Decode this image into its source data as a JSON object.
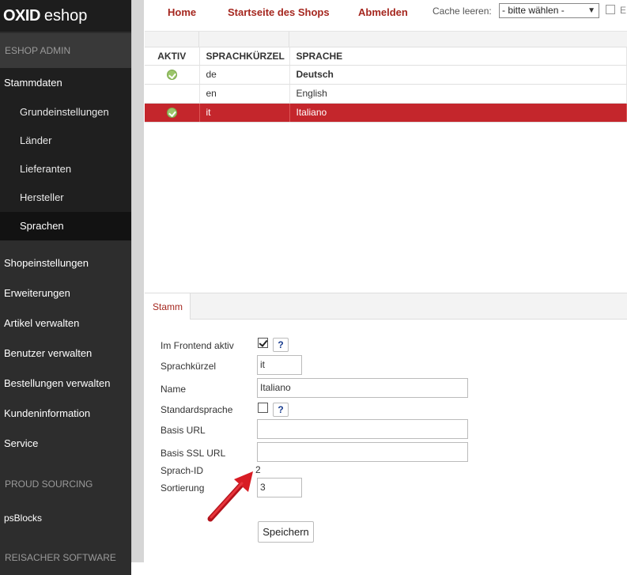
{
  "logo": {
    "brand": "OXID",
    "product": "eshop"
  },
  "sidebar": {
    "section_admin": "ESHOP ADMIN",
    "stammdaten": "Stammdaten",
    "sub_items": [
      "Grundeinstellungen",
      "Länder",
      "Lieferanten",
      "Hersteller",
      "Sprachen"
    ],
    "active_sub": "Sprachen",
    "menu_items": [
      "Shopeinstellungen",
      "Erweiterungen",
      "Artikel verwalten",
      "Benutzer verwalten",
      "Bestellungen verwalten",
      "Kundeninformation",
      "Service"
    ],
    "section_proud": "PROUD SOURCING",
    "psblocks": "psBlocks",
    "section_reisacher": "REISACHER SOFTWARE"
  },
  "topnav": {
    "home": "Home",
    "startseite": "Startseite des Shops",
    "abmelden": "Abmelden",
    "cache_label": "Cache leeren:",
    "cache_select": "- bitte wählen -",
    "extra_label": "E"
  },
  "list": {
    "headers": {
      "aktiv": "AKTIV",
      "kuerzel": "SPRACHKÜRZEL",
      "sprache": "SPRACHE"
    },
    "rows": [
      {
        "active": true,
        "code": "de",
        "name": "Deutsch",
        "bold": true,
        "selected": false
      },
      {
        "active": false,
        "code": "en",
        "name": "English",
        "bold": false,
        "selected": false
      },
      {
        "active": true,
        "code": "it",
        "name": "Italiano",
        "bold": false,
        "selected": true
      }
    ]
  },
  "edit": {
    "tab": "Stamm",
    "labels": {
      "frontend": "Im Frontend aktiv",
      "kuerzel": "Sprachkürzel",
      "name": "Name",
      "standard": "Standardsprache",
      "basis_url": "Basis URL",
      "basis_ssl": "Basis SSL URL",
      "sprach_id": "Sprach-ID",
      "sortierung": "Sortierung"
    },
    "values": {
      "frontend_checked": true,
      "kuerzel": "it",
      "name": "Italiano",
      "standard_checked": false,
      "basis_url": "",
      "basis_ssl": "",
      "sprach_id": "2",
      "sortierung": "3"
    },
    "help": "?",
    "save": "Speichern"
  },
  "colors": {
    "accent": "#a5271f",
    "selected_row": "#c4262c",
    "sidebar": "#2d2d2d"
  }
}
